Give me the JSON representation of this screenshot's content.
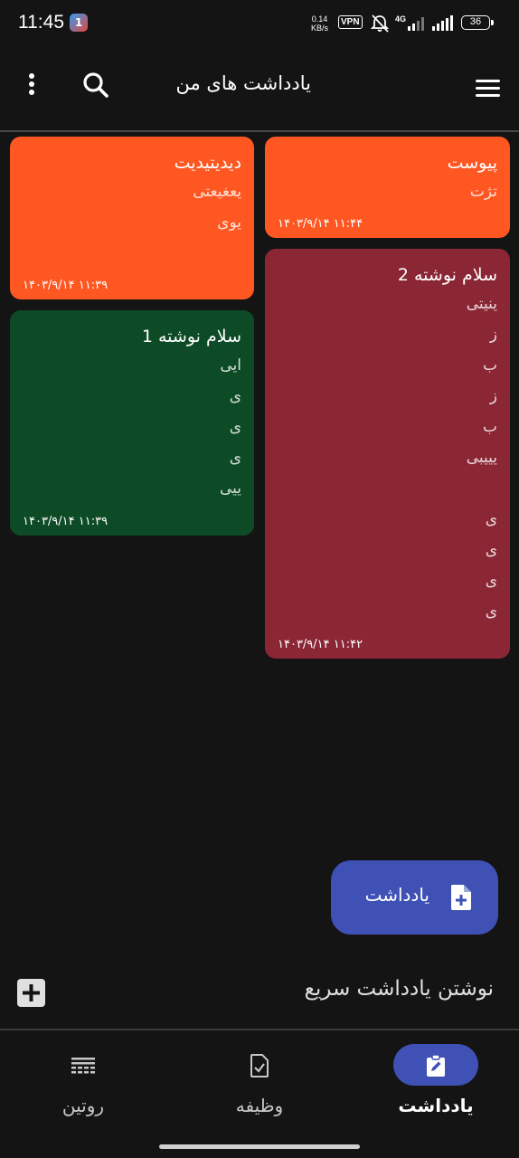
{
  "status_bar": {
    "time": "11:45",
    "app_badge": "1",
    "speed_value": "0.14",
    "speed_unit": "KB/s",
    "vpn": "VPN",
    "network": "4G",
    "battery": "36"
  },
  "header": {
    "title": "یادداشت های من"
  },
  "notes": [
    {
      "title": "پیوست",
      "lines": [
        "تژت"
      ],
      "date": "۱۴۰۳/۹/۱۴  ۱۱:۴۴",
      "color": "#ff5722"
    },
    {
      "title": "سلام نوشته 2",
      "lines": [
        "ینیتی",
        "ز",
        "ب",
        "ز",
        "ب",
        "یییبی",
        "",
        "ی",
        "ی",
        "ی",
        "ی"
      ],
      "date": "۱۴۰۳/۹/۱۴  ۱۱:۴۲",
      "color": "#8b2635"
    },
    {
      "title": "دیدیتیدیت",
      "lines": [
        "یعغیعتی",
        "یوی"
      ],
      "date": "۱۴۰۳/۹/۱۴  ۱۱:۳۹",
      "color": "#ff5722"
    },
    {
      "title": "سلام نوشته 1",
      "lines": [
        "ایی",
        "ی",
        "ی",
        "ی",
        "ییی"
      ],
      "date": "۱۴۰۳/۹/۱۴  ۱۱:۳۹",
      "color": "#0d4a26"
    }
  ],
  "fab": {
    "label": "یادداشت",
    "color": "#3f51b5"
  },
  "quick_note": {
    "placeholder": "نوشتن یادداشت سریع"
  },
  "bottom_nav": {
    "items": [
      {
        "label": "یادداشت",
        "icon": "note-edit-icon",
        "active": true
      },
      {
        "label": "وظیفه",
        "icon": "task-check-icon",
        "active": false
      },
      {
        "label": "روتین",
        "icon": "routine-icon",
        "active": false
      }
    ],
    "active_color": "#3f51b5"
  }
}
